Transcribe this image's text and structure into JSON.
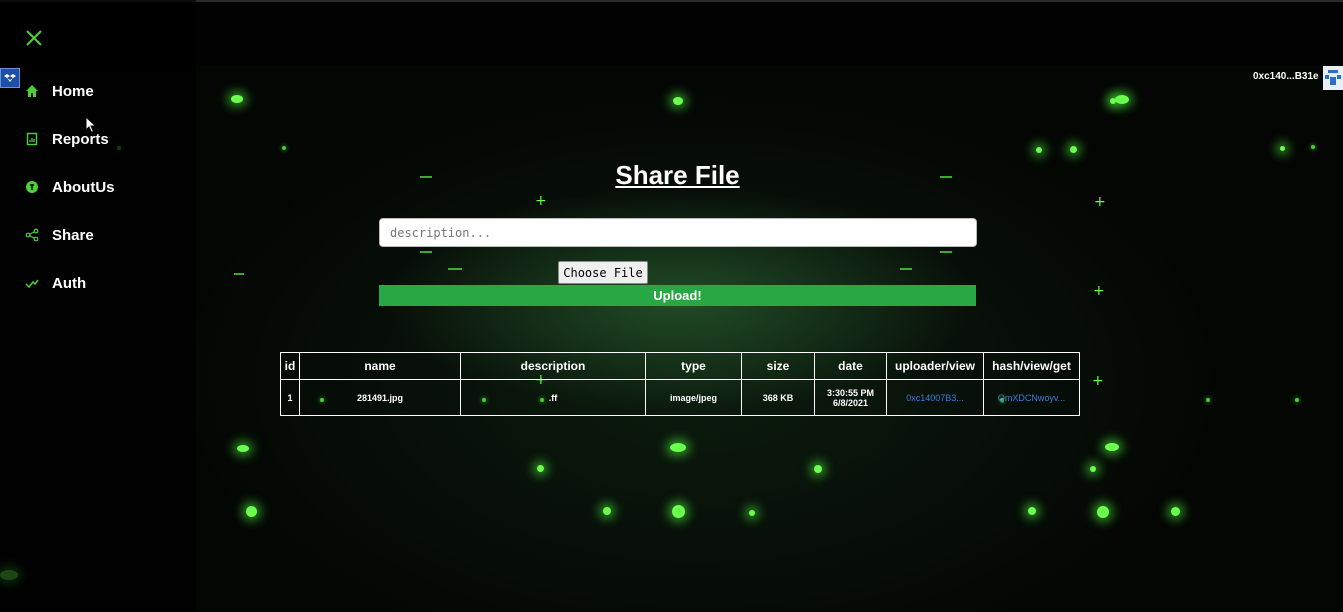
{
  "sidebar": {
    "close_icon": "close-x-icon",
    "items": [
      {
        "label": "Home",
        "icon": "home-icon"
      },
      {
        "label": "Reports",
        "icon": "report-icon"
      },
      {
        "label": "AboutUs",
        "icon": "info-icon"
      },
      {
        "label": "Share",
        "icon": "share-icon"
      },
      {
        "label": "Auth",
        "icon": "check-icon"
      }
    ]
  },
  "header": {
    "account": "0xc140...B31e"
  },
  "main": {
    "title": "Share File",
    "description_placeholder": "description...",
    "choose_file_label": "Choose File",
    "upload_label": "Upload!"
  },
  "table": {
    "headers": [
      "id",
      "name",
      "description",
      "type",
      "size",
      "date",
      "uploader/view",
      "hash/view/get"
    ],
    "rows": [
      {
        "id": "1",
        "name": "281491.jpg",
        "description": ".ff",
        "type": "image/jpeg",
        "size": "368 KB",
        "time": "3:30:55 PM",
        "date": "6/8/2021",
        "uploader": "0xc14007B3...",
        "hash": "QmXDCNwoyv..."
      }
    ]
  },
  "colors": {
    "accent_green": "#28a745",
    "icon_green": "#4cd137",
    "link_blue": "#3b7ddb",
    "background": "#040604"
  }
}
